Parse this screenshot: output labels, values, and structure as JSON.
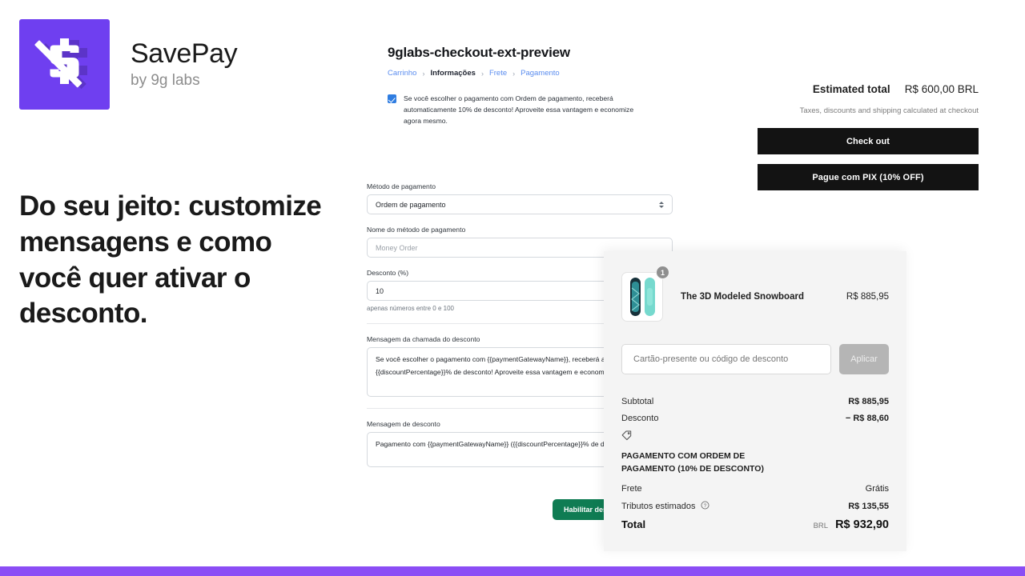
{
  "brand": {
    "name": "SavePay",
    "tagline": "by 9g labs",
    "logo_icon": "struck-through-dollar-icon",
    "logo_color": "#6f3ff0"
  },
  "headline": "Do seu jeito: customize mensagens e como você quer ativar o desconto.",
  "app": {
    "title": "9glabs-checkout-ext-preview",
    "breadcrumbs": [
      {
        "label": "Carrinho",
        "active": false
      },
      {
        "label": "Informações",
        "active": true
      },
      {
        "label": "Frete",
        "active": false
      },
      {
        "label": "Pagamento",
        "active": false
      }
    ],
    "breadcrumb_separator": "›",
    "notice": {
      "checked": true,
      "text": "Se você escolher o pagamento com Ordem de pagamento, receberá automaticamente 10% de desconto! Aproveite essa vantagem e economize agora mesmo."
    },
    "fields": {
      "method_label": "Método de pagamento",
      "method_value": "Ordem de pagamento",
      "method_name_label": "Nome do método de pagamento",
      "method_name_placeholder": "Money Order",
      "discount_label": "Desconto (%)",
      "discount_value": "10",
      "discount_hint": "apenas números entre 0 e 100",
      "call_message_label": "Mensagem da chamada do desconto",
      "call_message_value": "Se você escolher o pagamento com {{paymentGatewayName}}, receberá automaticamente {{discountPercentage}}% de desconto! Aproveite essa vantagem e economize agora mesmo.",
      "discount_message_label": "Mensagem de desconto",
      "discount_message_value": "Pagamento com {{paymentGatewayName}} ({{discountPercentage}}% de desconto)"
    },
    "submit_label": "Habilitar desconto"
  },
  "estimated": {
    "label": "Estimated total",
    "value": "R$ 600,00 BRL",
    "note": "Taxes, discounts and shipping calculated at checkout",
    "checkout_label": "Check out",
    "pix_label": "Pague com PIX (10% OFF)"
  },
  "cart": {
    "item": {
      "name": "The 3D Modeled Snowboard",
      "price": "R$ 885,95",
      "quantity": "1"
    },
    "promo_placeholder": "Cartão-presente ou código de desconto",
    "promo_button": "Aplicar",
    "totals": {
      "subtotal_label": "Subtotal",
      "subtotal_value": "R$ 885,95",
      "discount_label": "Desconto",
      "discount_value": "− R$ 88,60",
      "discount_code": "PAGAMENTO COM ORDEM DE PAGAMENTO (10% DE DESCONTO)",
      "shipping_label": "Frete",
      "shipping_value": "Grátis",
      "tax_label": "Tributos estimados",
      "tax_value": "R$ 135,55",
      "total_label": "Total",
      "total_currency": "BRL",
      "total_value": "R$ 932,90"
    }
  },
  "accent_color": "#8b4df5"
}
